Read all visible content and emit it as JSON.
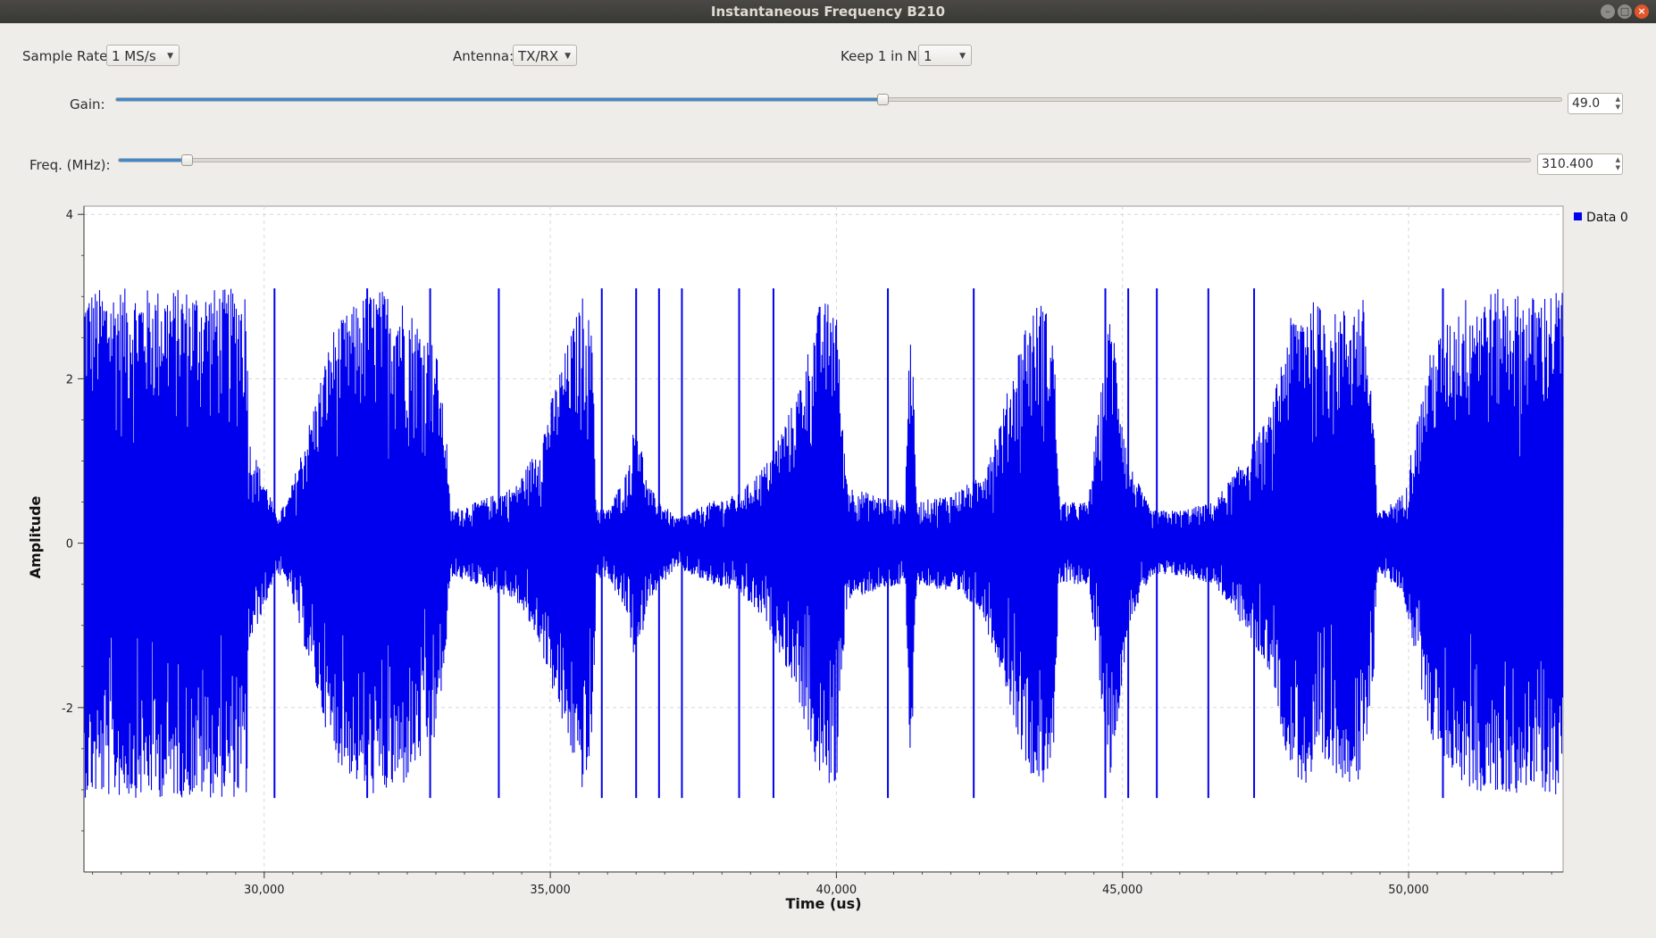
{
  "window": {
    "title": "Instantaneous Frequency B210"
  },
  "controls": {
    "sample_rate": {
      "label": "Sample Rate:",
      "value": "1 MS/s"
    },
    "antenna": {
      "label": "Antenna:",
      "value": "TX/RX"
    },
    "keep": {
      "label": "Keep 1 in N:",
      "value": "1"
    },
    "gain": {
      "label": "Gain:",
      "value": "49.0",
      "fraction": 0.53
    },
    "freq": {
      "label": "Freq. (MHz):",
      "value": "310.400",
      "fraction": 0.048
    }
  },
  "icons": {
    "minimize": "minimize-icon",
    "maximize": "maximize-icon",
    "close": "close-icon"
  },
  "chart_data": {
    "type": "line",
    "xlabel": "Time (us)",
    "ylabel": "Amplitude",
    "xlim": [
      26850,
      52700
    ],
    "ylim": [
      -4.0,
      4.1
    ],
    "xticks": [
      30000,
      35000,
      40000,
      45000,
      50000
    ],
    "xtick_labels": [
      "30,000",
      "35,000",
      "40,000",
      "45,000",
      "50,000"
    ],
    "yticks": [
      4,
      2,
      0,
      -2
    ],
    "ytick_labels": [
      "4",
      "2",
      "0",
      "-2"
    ],
    "grid": true,
    "legend_position": "top-right",
    "series": [
      {
        "name": "Data 0",
        "color": "#0000ee"
      }
    ],
    "envelope": {
      "x": [
        26850,
        29700,
        29720,
        30100,
        30200,
        30400,
        30800,
        31200,
        31700,
        32000,
        32400,
        33000,
        33200,
        33250,
        33700,
        34400,
        34800,
        35200,
        35600,
        35750,
        35800,
        36000,
        36350,
        36500,
        36700,
        37200,
        37800,
        38300,
        38800,
        39300,
        39700,
        40000,
        40100,
        40200,
        40600,
        41200,
        41300,
        41400,
        42000,
        42500,
        42900,
        43300,
        43600,
        43800,
        43900,
        44400,
        44800,
        45100,
        45500,
        46000,
        46600,
        47000,
        47600,
        47900,
        48200,
        48700,
        49200,
        49400,
        49450,
        49900,
        50400,
        51000,
        51600,
        52100,
        52700
      ],
      "amp": [
        3.1,
        3.1,
        1.3,
        0.6,
        0.35,
        0.5,
        1.5,
        2.6,
        3.0,
        3.1,
        3.0,
        2.4,
        1.2,
        0.4,
        0.5,
        0.7,
        1.2,
        2.2,
        3.1,
        2.4,
        0.45,
        0.4,
        0.9,
        1.6,
        0.7,
        0.3,
        0.5,
        0.6,
        1.0,
        1.8,
        2.9,
        3.0,
        1.5,
        0.7,
        0.6,
        0.5,
        3.1,
        0.5,
        0.6,
        0.8,
        1.6,
        2.7,
        3.0,
        2.5,
        0.5,
        0.5,
        2.9,
        1.0,
        0.4,
        0.4,
        0.5,
        0.9,
        1.6,
        2.7,
        3.0,
        2.8,
        3.0,
        1.5,
        0.35,
        0.6,
        2.4,
        3.0,
        3.1,
        3.0,
        3.1
      ]
    },
    "spikes_x": [
      30180,
      31800,
      32900,
      34100,
      35900,
      36500,
      36900,
      37300,
      38300,
      38900,
      40900,
      42400,
      44700,
      45100,
      45600,
      46500,
      47300,
      50600
    ]
  }
}
